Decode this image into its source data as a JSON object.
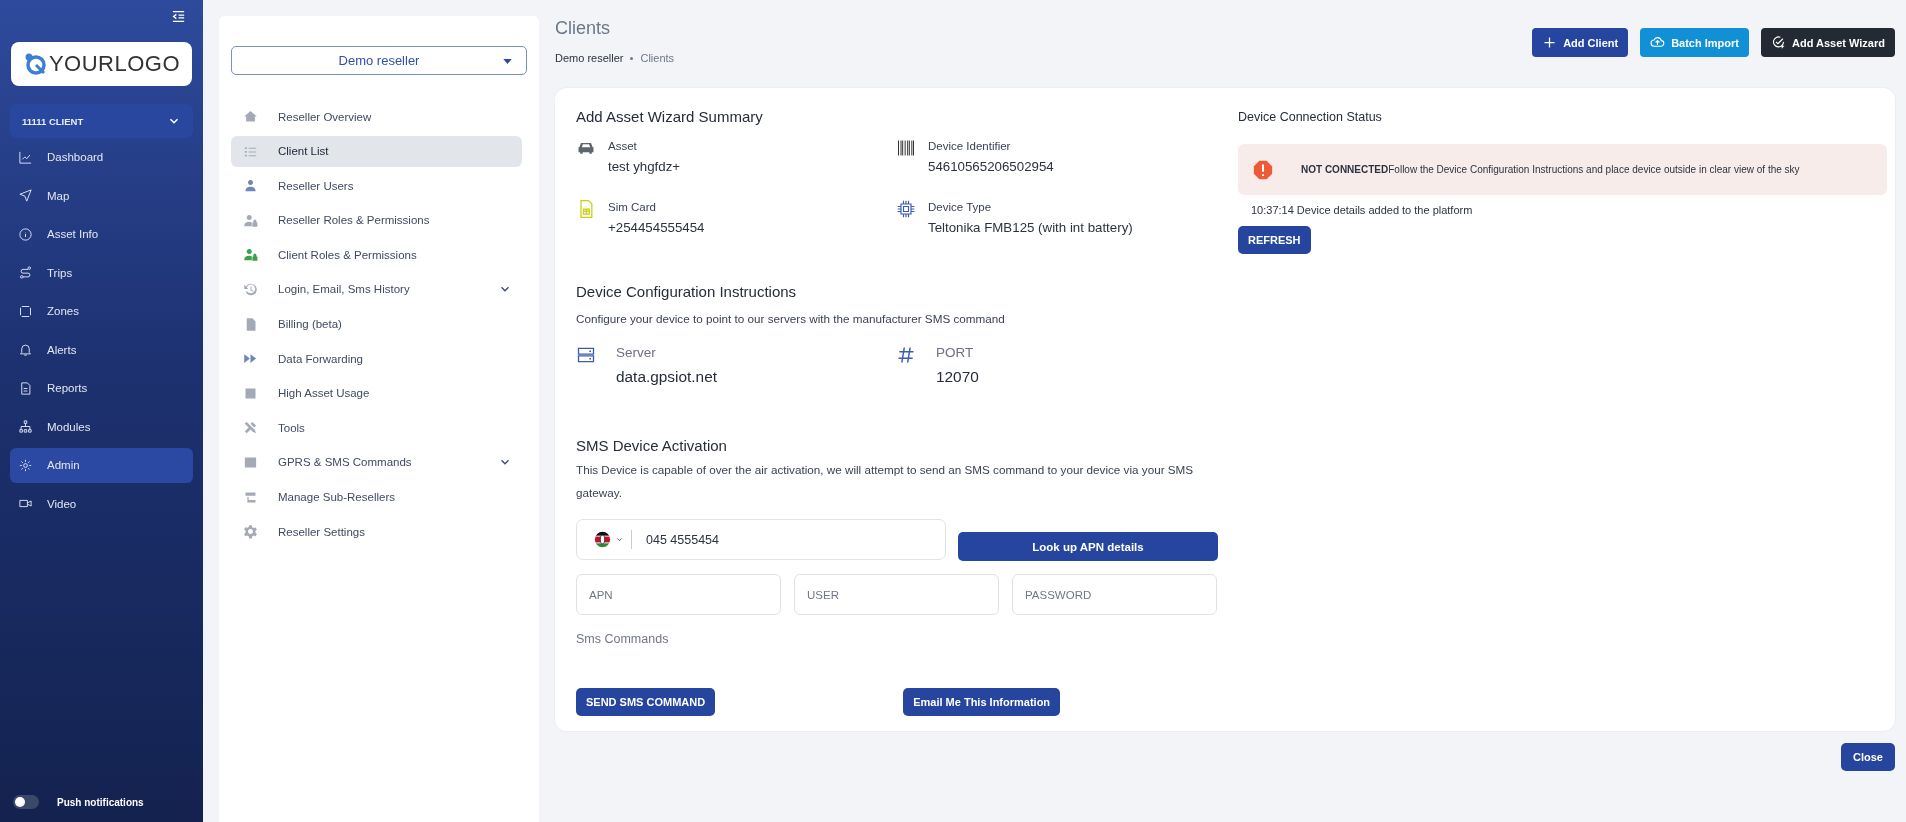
{
  "sidebar": {
    "logo": "**YOUR**LOGO",
    "client_selector": "11111 CLIENT",
    "items": [
      {
        "label": "Dashboard",
        "selected": false
      },
      {
        "label": "Map",
        "selected": false
      },
      {
        "label": "Asset Info",
        "selected": false
      },
      {
        "label": "Trips",
        "selected": false
      },
      {
        "label": "Zones",
        "selected": false
      },
      {
        "label": "Alerts",
        "selected": false
      },
      {
        "label": "Reports",
        "selected": false
      },
      {
        "label": "Modules",
        "selected": false
      },
      {
        "label": "Admin",
        "selected": true
      },
      {
        "label": "Video",
        "selected": false
      }
    ],
    "push_notifications": {
      "label": "Push notifications",
      "on": false
    }
  },
  "reseller_nav": {
    "selector": "Demo reseller",
    "items": [
      {
        "label": "Reseller Overview",
        "selected": false,
        "kind": "link"
      },
      {
        "label": "Client List",
        "selected": true,
        "kind": "link"
      },
      {
        "label": "Reseller Users",
        "selected": false,
        "kind": "link"
      },
      {
        "label": "Reseller Roles & Permissions",
        "selected": false,
        "kind": "link"
      },
      {
        "label": "Client Roles & Permissions",
        "selected": false,
        "kind": "link"
      },
      {
        "label": "Login, Email, Sms History",
        "selected": false,
        "kind": "group",
        "expanded": false
      },
      {
        "label": "Billing (beta)",
        "selected": false,
        "kind": "link"
      },
      {
        "label": "Data Forwarding",
        "selected": false,
        "kind": "link"
      },
      {
        "label": "High Asset Usage",
        "selected": false,
        "kind": "link"
      },
      {
        "label": "Tools",
        "selected": false,
        "kind": "link"
      },
      {
        "label": "GPRS & SMS Commands",
        "selected": false,
        "kind": "group",
        "expanded": false
      },
      {
        "label": "Manage Sub-Resellers",
        "selected": false,
        "kind": "link"
      },
      {
        "label": "Reseller Settings",
        "selected": false,
        "kind": "link"
      }
    ]
  },
  "header": {
    "title": "Clients",
    "breadcrumb": [
      "Demo reseller",
      "Clients"
    ],
    "buttons": [
      {
        "label": "Add Client",
        "kind": "primary"
      },
      {
        "label": "Batch Import",
        "kind": "info"
      },
      {
        "label": "Add Asset Wizard",
        "kind": "dark"
      }
    ]
  },
  "summary": {
    "title": "Add Asset Wizard Summary",
    "fields": [
      {
        "label": "Asset",
        "value": "test yhgfdz+"
      },
      {
        "label": "Device Identifier",
        "value": "54610565206502954"
      },
      {
        "label": "Sim Card",
        "value": "+254454555454"
      },
      {
        "label": "Device Type",
        "value": "Teltonika FMB125 (with int battery)"
      }
    ]
  },
  "configuration": {
    "title": "Device Configuration Instructions",
    "description": "Configure your device to point to our servers with the manufacturer SMS command",
    "fields": [
      {
        "label": "Server",
        "value": "data.gpsiot.net"
      },
      {
        "label": "PORT",
        "value": "12070"
      }
    ]
  },
  "sms_activation": {
    "title": "SMS Device Activation",
    "description": "This Device is capable of over the air activation, we will attempt to send an SMS command to your device via your SMS gateway.",
    "phone": "045 4555454",
    "lookup_button": "Look up APN details",
    "apn_fields": [
      {
        "placeholder": "APN"
      },
      {
        "placeholder": "USER"
      },
      {
        "placeholder": "PASSWORD"
      }
    ],
    "commands_label": "Sms Commands",
    "send_button": "SEND SMS COMMAND",
    "email_button": "Email Me This Information"
  },
  "connection_status": {
    "title": "Device Connection Status",
    "alert": "**NOT CONNECTED**Follow the Device Configuration Instructions and place device outside in clear view of the sky",
    "log": "10:37:14 Device details added to the platform",
    "refresh_button": "REFRESH"
  },
  "close_button": "Close"
}
